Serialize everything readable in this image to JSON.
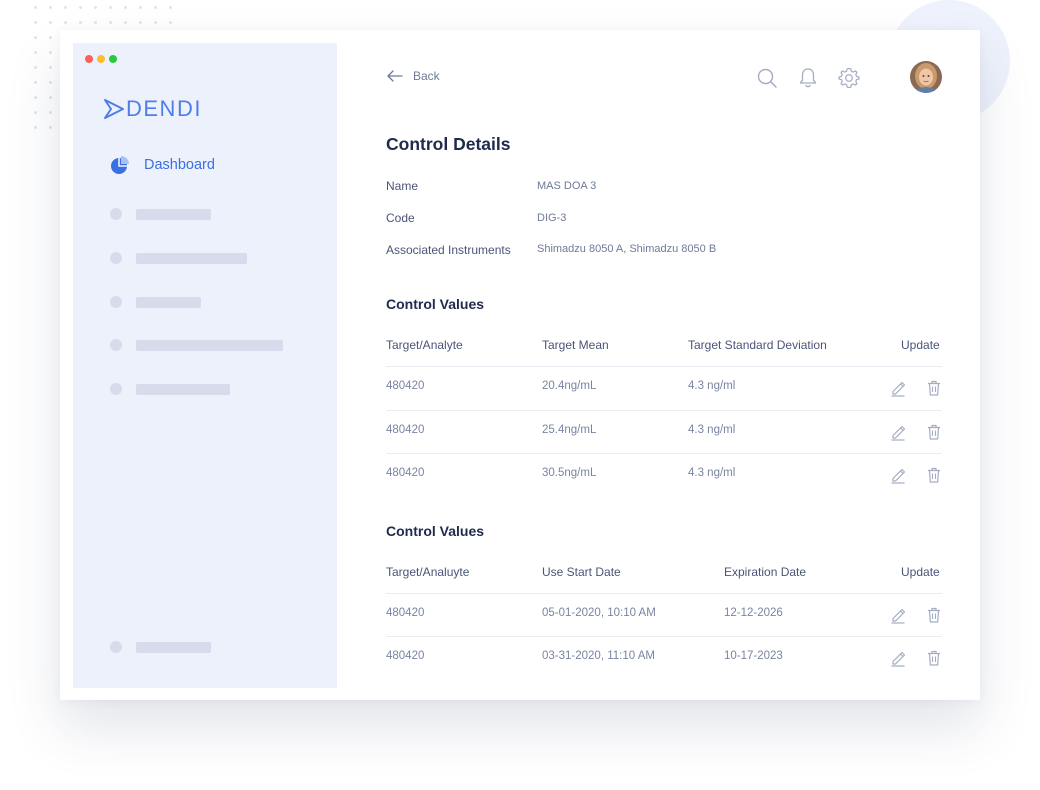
{
  "window": {
    "traffic_lights": {
      "close": "#fd5f57",
      "minimize": "#fdbc2e",
      "maximize": "#28c941"
    }
  },
  "sidebar": {
    "logo_text": "DENDI",
    "active_item": {
      "label": "Dashboard",
      "icon": "pie-chart-icon"
    },
    "accent_color": "#3b6fe2"
  },
  "header": {
    "back_label": "Back",
    "icons": [
      "search-icon",
      "bell-icon",
      "gear-icon"
    ]
  },
  "details": {
    "title": "Control Details",
    "fields": [
      {
        "label": "Name",
        "value": "MAS DOA 3"
      },
      {
        "label": "Code",
        "value": "DIG-3"
      },
      {
        "label": "Associated Instruments",
        "value": "Shimadzu 8050 A, Shimadzu 8050 B"
      }
    ]
  },
  "values_table": {
    "title": "Control Values",
    "headers": [
      "Target/Analyte",
      "Target Mean",
      "Target Standard Deviation",
      "Update"
    ],
    "rows": [
      [
        "480420",
        "20.4ng/mL",
        "4.3 ng/ml"
      ],
      [
        "480420",
        "25.4ng/mL",
        "4.3 ng/ml"
      ],
      [
        "480420",
        "30.5ng/mL",
        "4.3 ng/ml"
      ]
    ]
  },
  "dates_table": {
    "title": "Control Values",
    "headers": [
      "Target/Analuyte",
      "Use Start Date",
      "Expiration Date",
      "Update"
    ],
    "rows": [
      [
        "480420",
        "05-01-2020, 10:10 AM",
        "12-12-2026"
      ],
      [
        "480420",
        "03-31-2020, 11:10 AM",
        "10-17-2023"
      ]
    ]
  },
  "row_actions": [
    "edit-icon",
    "trash-icon"
  ]
}
